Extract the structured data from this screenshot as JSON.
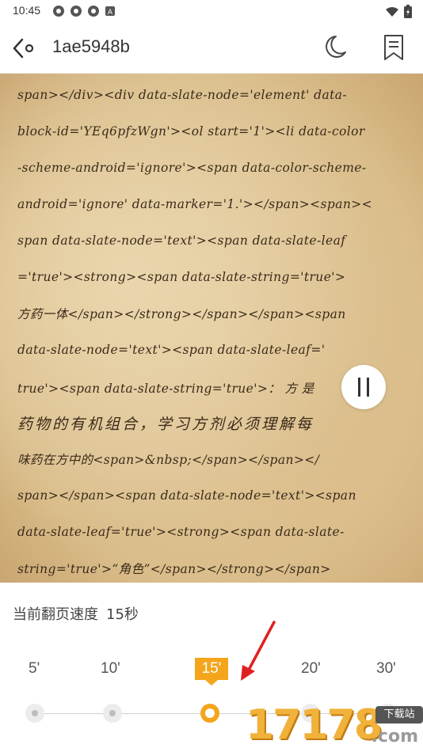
{
  "status_bar": {
    "time": "10:45",
    "left_icons": [
      "app-notification-icon",
      "app-notification-icon",
      "app-notification-icon",
      "a-badge-icon"
    ],
    "right_icons": [
      "wifi-icon",
      "battery-icon"
    ]
  },
  "header": {
    "title": "1ae5948b",
    "back_icon": "back-arrow-icon",
    "night_mode_icon": "moon-icon",
    "bookmark_icon": "bookmark-icon"
  },
  "reader": {
    "lines": [
      "span></div><div  data-slate-node='element'  data-",
      "block-id='YEq6pfzWgn'><ol start='1'><li data-color",
      "-scheme-android='ignore'><span data-color-scheme-",
      "android='ignore'   data-marker='1.'></span><span><",
      "span data-slate-node='text'><span data-slate-leaf",
      "='true'><strong><span    data-slate-string='true'>",
      "方药一体</span></strong></span></span><span",
      "data-slate-node='text'><span    data-slate-leaf='",
      "true'><span data-slate-string='true'>：  方  是",
      "药物的有机组合，学习方剂必须理解每",
      "味药在方中的<span>&nbsp;</span></span></",
      "span></span><span   data-slate-node='text'><span",
      "data-slate-leaf='true'><strong><span data-slate-",
      "string='true'>“角色”</span></strong></span>"
    ],
    "pause_icon": "pause-icon"
  },
  "panel": {
    "speed_label": "当前翻页速度",
    "speed_value": "15秒",
    "ticks": [
      "5'",
      "10'",
      "15'",
      "20'",
      "30'"
    ],
    "selected_tick": "15'",
    "selected_index": 2
  },
  "watermark": {
    "digits": "17178",
    "badge": "下载站",
    "suffix": ".com"
  },
  "colors": {
    "accent": "#f4a51c",
    "annotation": "#e02020",
    "paper": "#ddc394"
  }
}
